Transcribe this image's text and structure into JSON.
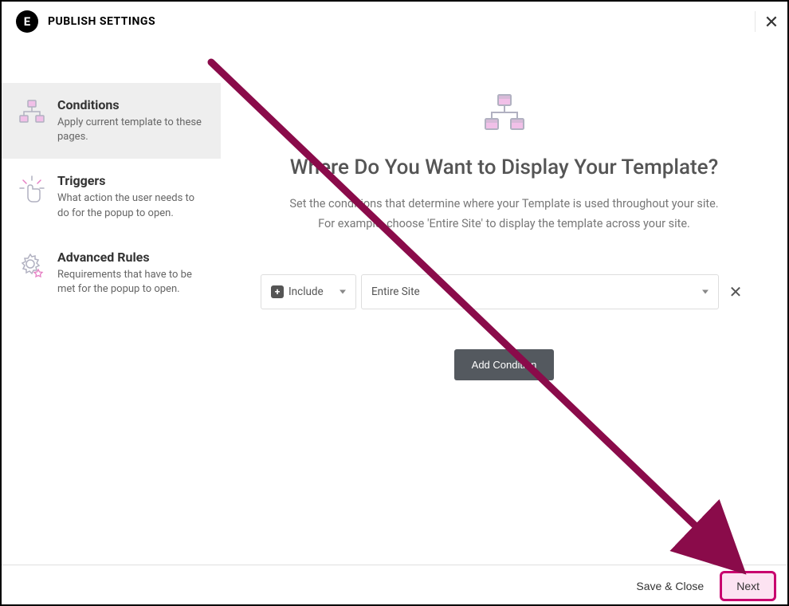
{
  "header": {
    "title": "PUBLISH SETTINGS",
    "logo_letter": "E"
  },
  "sidebar": {
    "items": [
      {
        "title": "Conditions",
        "desc": "Apply current template to these pages."
      },
      {
        "title": "Triggers",
        "desc": "What action the user needs to do for the popup to open."
      },
      {
        "title": "Advanced Rules",
        "desc": "Requirements that have to be met for the popup to open."
      }
    ]
  },
  "main": {
    "heading": "Where Do You Want to Display Your Template?",
    "lead_line1": "Set the conditions that determine where your Template is used throughout your site.",
    "lead_line2": "For example, choose 'Entire Site' to display the template across your site.",
    "include_label": "Include",
    "scope_label": "Entire Site",
    "add_button": "Add Condition"
  },
  "footer": {
    "save_close": "Save & Close",
    "next": "Next"
  }
}
